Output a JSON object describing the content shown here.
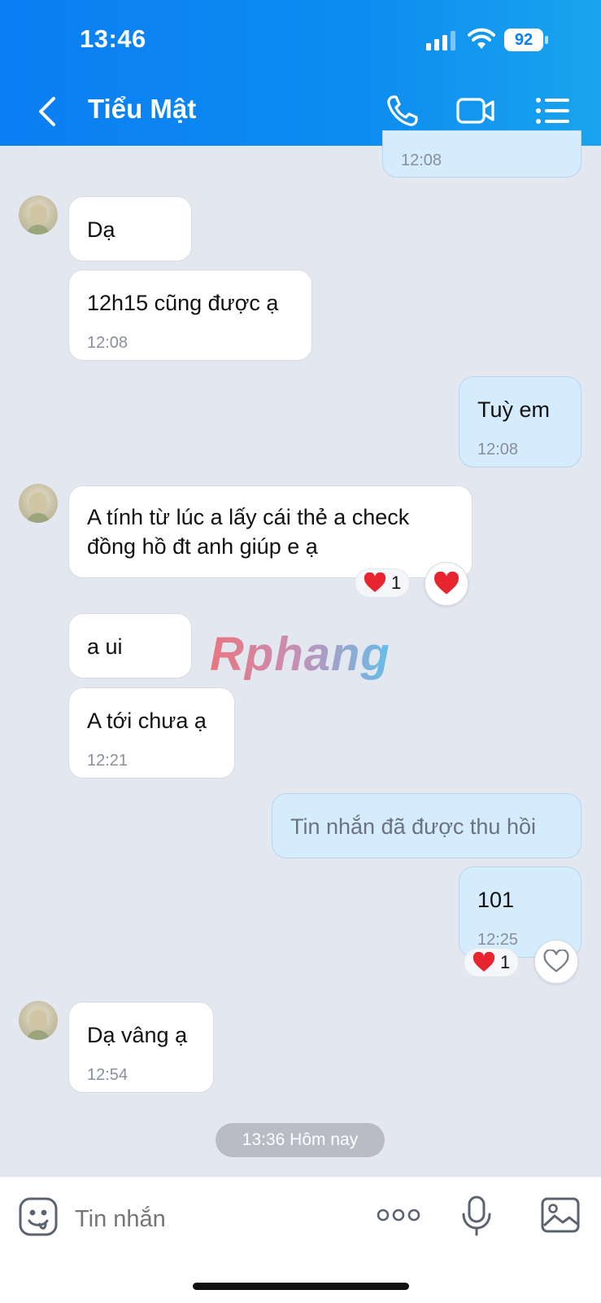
{
  "status_bar": {
    "time": "13:46",
    "battery": "92"
  },
  "header": {
    "title": "Tiểu Mật"
  },
  "messages": [
    {
      "id": "m0",
      "time": "12:08"
    },
    {
      "id": "m1",
      "text": "Dạ"
    },
    {
      "id": "m2",
      "text": "12h15 cũng được ạ",
      "time": "12:08"
    },
    {
      "id": "m3",
      "text": "Tuỳ em",
      "time": "12:08"
    },
    {
      "id": "m4",
      "line1": "A tính từ lúc a lấy cái thẻ a check",
      "line2": "đồng hồ đt anh giúp e ạ",
      "reaction_count": "1"
    },
    {
      "id": "m5",
      "text": "a ui"
    },
    {
      "id": "m6",
      "text": "A tới chưa ạ",
      "time": "12:21"
    },
    {
      "id": "m7",
      "text": "Tin nhắn đã được thu hồi"
    },
    {
      "id": "m8",
      "text": "101",
      "time": "12:25",
      "reaction_count": "1"
    },
    {
      "id": "m9",
      "text": "Dạ vâng ạ",
      "time": "12:54"
    }
  ],
  "date_separator": "13:36 Hôm nay",
  "watermark": "Rphang",
  "composer": {
    "placeholder": "Tin nhắn"
  },
  "colors": {
    "accent": "#0a7ef3",
    "outgoing_bubble": "#d4ecfb",
    "chat_bg": "#e3e7f0",
    "heart": "#e8242f"
  }
}
